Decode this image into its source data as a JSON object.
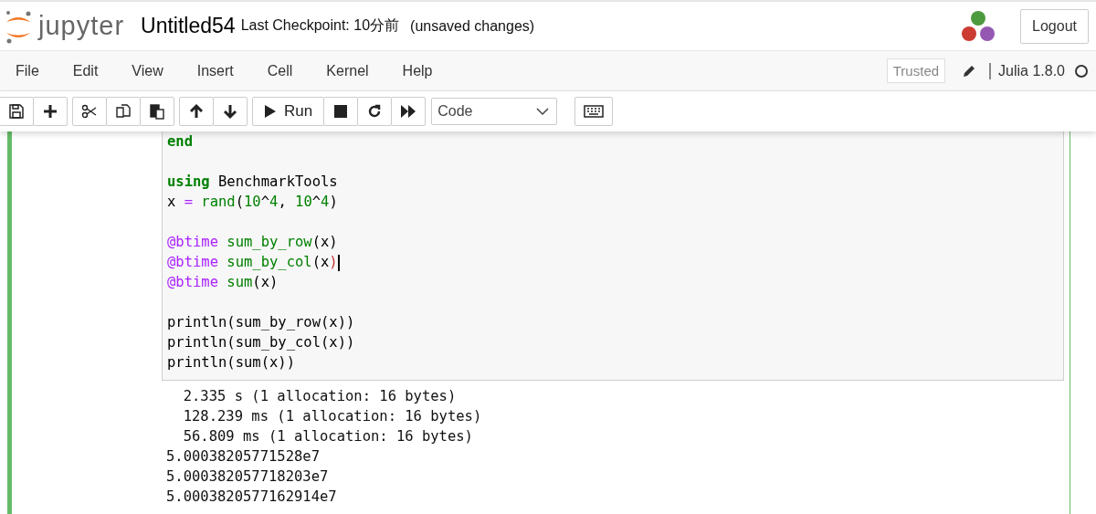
{
  "header": {
    "logo_text": "jupyter",
    "notebook_name": "Untitled54",
    "checkpoint": "Last Checkpoint: 10分前",
    "unsaved": "(unsaved changes)",
    "logout": "Logout"
  },
  "menu": [
    "File",
    "Edit",
    "View",
    "Insert",
    "Cell",
    "Kernel",
    "Help"
  ],
  "kernel_bar": {
    "trusted": "Trusted",
    "kernel_name": "Julia 1.8.0",
    "busy": false
  },
  "toolbar": {
    "groups": [
      [
        {
          "kind": "save"
        },
        {
          "kind": "add"
        }
      ],
      [
        {
          "kind": "cut"
        },
        {
          "kind": "copy"
        },
        {
          "kind": "paste"
        }
      ],
      [
        {
          "kind": "up"
        },
        {
          "kind": "down"
        }
      ],
      [
        {
          "kind": "run",
          "label": "Run"
        },
        {
          "kind": "stop"
        },
        {
          "kind": "restart"
        },
        {
          "kind": "fast-forward"
        }
      ]
    ],
    "cell_type": "Code"
  },
  "cell": {
    "selected": true,
    "code_blocks": [
      [
        {
          "cursor": false,
          "tokens": [
            {
              "t": "end",
              "kind": "keyword"
            }
          ]
        }
      ],
      [
        {
          "cursor": false,
          "tokens": [
            {
              "t": "using",
              "kind": "keyword"
            },
            {
              "t": " BenchmarkTools",
              "kind": "plain"
            }
          ]
        },
        {
          "cursor": false,
          "tokens": [
            {
              "t": "x",
              "kind": "plain"
            },
            {
              "t": " = ",
              "kind": "operator"
            },
            {
              "t": "rand",
              "kind": "builtin"
            },
            {
              "t": "(",
              "kind": "plain"
            },
            {
              "t": "10",
              "kind": "number"
            },
            {
              "t": "^",
              "kind": "plain"
            },
            {
              "t": "4",
              "kind": "number"
            },
            {
              "t": ", ",
              "kind": "plain"
            },
            {
              "t": "10",
              "kind": "number"
            },
            {
              "t": "^",
              "kind": "plain"
            },
            {
              "t": "4",
              "kind": "number"
            },
            {
              "t": ")",
              "kind": "plain"
            }
          ]
        }
      ],
      [
        {
          "cursor": false,
          "tokens": [
            {
              "t": "@btime",
              "kind": "macro"
            },
            {
              "t": " sum_by_row",
              "kind": "builtin"
            },
            {
              "t": "(x)",
              "kind": "plain"
            }
          ]
        },
        {
          "cursor": true,
          "tokens": [
            {
              "t": "@btime",
              "kind": "macro"
            },
            {
              "t": " sum_by_col",
              "kind": "builtin"
            },
            {
              "t": "(x",
              "kind": "plain"
            },
            {
              "t": ")",
              "kind": "bracket"
            }
          ]
        },
        {
          "cursor": false,
          "tokens": [
            {
              "t": "@btime",
              "kind": "macro"
            },
            {
              "t": " sum",
              "kind": "builtin"
            },
            {
              "t": "(x)",
              "kind": "plain"
            }
          ]
        }
      ],
      [
        {
          "cursor": false,
          "tokens": [
            {
              "t": "println(sum_by_row(x))",
              "kind": "plain"
            }
          ]
        },
        {
          "cursor": false,
          "tokens": [
            {
              "t": "println(sum_by_col(x))",
              "kind": "plain"
            }
          ]
        },
        {
          "cursor": false,
          "tokens": [
            {
              "t": "println(sum(x))",
              "kind": "plain"
            }
          ]
        }
      ]
    ],
    "output": [
      "  2.335 s (1 allocation: 16 bytes)",
      "  128.239 ms (1 allocation: 16 bytes)",
      "  56.809 ms (1 allocation: 16 bytes)",
      "5.00038205771528e7",
      "5.000382057718203e7",
      "5.0003820577162914e7"
    ]
  }
}
